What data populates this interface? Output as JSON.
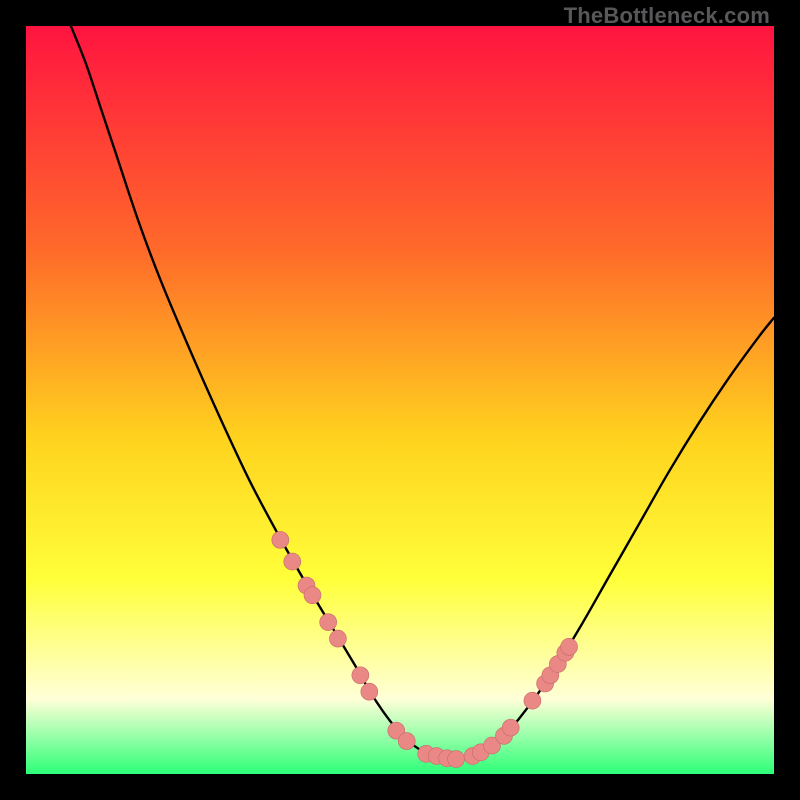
{
  "watermark": "TheBottleneck.com",
  "colors": {
    "gradient_top": "#ff1440",
    "gradient_mid1": "#ff6a2a",
    "gradient_mid2": "#ffd21e",
    "gradient_mid3": "#ffff3a",
    "gradient_pale": "#ffffd8",
    "gradient_bottom": "#2cff77",
    "curve": "#000000",
    "marker_fill": "#e98885",
    "marker_stroke": "#c76a6a"
  },
  "chart_data": {
    "type": "line",
    "title": "",
    "xlabel": "",
    "ylabel": "",
    "xlim": [
      0,
      100
    ],
    "ylim": [
      0,
      100
    ],
    "grid": false,
    "legend": false,
    "series": [
      {
        "name": "bottleneck-curve",
        "x": [
          6,
          8,
          10,
          12,
          15,
          18,
          22,
          26,
          30,
          34,
          38,
          41,
          44,
          46,
          48,
          50,
          52,
          54,
          56,
          58,
          60,
          63,
          66,
          70,
          74,
          78,
          82,
          86,
          90,
          94,
          98,
          100
        ],
        "y": [
          100,
          95,
          89,
          83,
          74,
          66,
          56.5,
          47.5,
          39,
          31.5,
          24.5,
          19.5,
          14.5,
          11,
          8,
          5.5,
          3.7,
          2.6,
          2.1,
          2.0,
          2.5,
          4.2,
          7.5,
          13.0,
          19.5,
          26.5,
          33.5,
          40.5,
          47.0,
          53.0,
          58.5,
          61.0
        ]
      }
    ],
    "markers": [
      {
        "x": 34.0,
        "y": 31.3
      },
      {
        "x": 35.6,
        "y": 28.4
      },
      {
        "x": 37.5,
        "y": 25.2
      },
      {
        "x": 38.3,
        "y": 23.9
      },
      {
        "x": 40.4,
        "y": 20.3
      },
      {
        "x": 41.7,
        "y": 18.1
      },
      {
        "x": 44.7,
        "y": 13.2
      },
      {
        "x": 45.9,
        "y": 11.0
      },
      {
        "x": 49.5,
        "y": 5.8
      },
      {
        "x": 50.9,
        "y": 4.4
      },
      {
        "x": 53.5,
        "y": 2.7
      },
      {
        "x": 54.9,
        "y": 2.4
      },
      {
        "x": 56.3,
        "y": 2.1
      },
      {
        "x": 57.5,
        "y": 2.0
      },
      {
        "x": 59.7,
        "y": 2.4
      },
      {
        "x": 60.8,
        "y": 2.9
      },
      {
        "x": 62.3,
        "y": 3.8
      },
      {
        "x": 63.9,
        "y": 5.1
      },
      {
        "x": 64.8,
        "y": 6.2
      },
      {
        "x": 67.7,
        "y": 9.8
      },
      {
        "x": 69.4,
        "y": 12.1
      },
      {
        "x": 70.1,
        "y": 13.2
      },
      {
        "x": 71.1,
        "y": 14.7
      },
      {
        "x": 72.1,
        "y": 16.2
      },
      {
        "x": 72.6,
        "y": 17.0
      }
    ]
  }
}
